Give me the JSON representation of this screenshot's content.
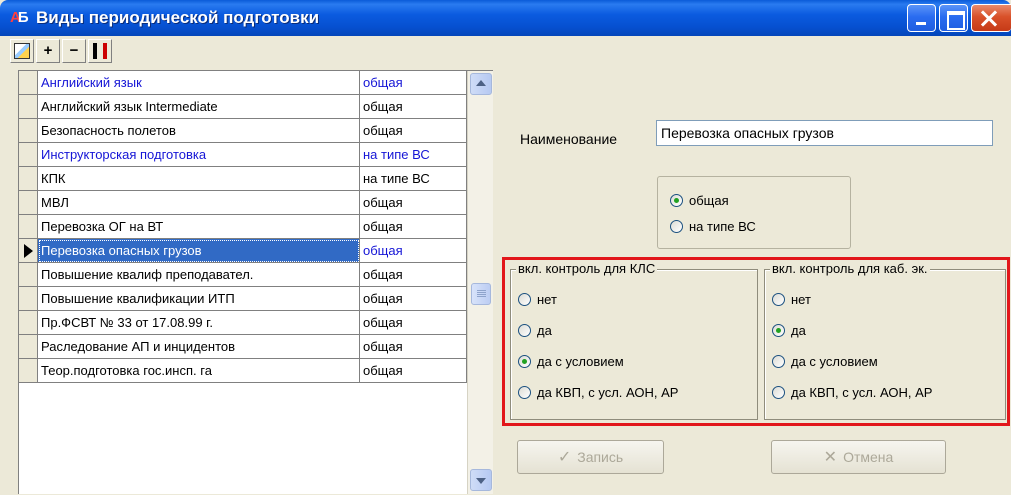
{
  "window": {
    "title": "Виды периодической подготовки",
    "icon_text": [
      "А",
      "Б"
    ]
  },
  "toolbar": {
    "edit_icon": "edit-document-icon",
    "add_icon": "+",
    "remove_icon": "−",
    "move_icon": "move-icon"
  },
  "grid": {
    "rows": [
      {
        "name": "Английский язык",
        "type": "общая",
        "blue": true,
        "selected": false
      },
      {
        "name": "Английский язык Intermediate",
        "type": "общая",
        "blue": false,
        "selected": false
      },
      {
        "name": "Безопасность полетов",
        "type": "общая",
        "blue": false,
        "selected": false
      },
      {
        "name": "Инструкторская подготовка",
        "type": "на типе ВС",
        "blue": true,
        "selected": false
      },
      {
        "name": "КПК",
        "type": "на типе ВС",
        "blue": false,
        "selected": false
      },
      {
        "name": "МВЛ",
        "type": "общая",
        "blue": false,
        "selected": false
      },
      {
        "name": "Перевозка ОГ на ВТ",
        "type": "общая",
        "blue": false,
        "selected": false
      },
      {
        "name": "Перевозка опасных грузов",
        "type": "общая",
        "blue": true,
        "selected": true
      },
      {
        "name": "Повышение квалиф преподавател.",
        "type": "общая",
        "blue": false,
        "selected": false
      },
      {
        "name": "Повышение квалификации ИТП",
        "type": "общая",
        "blue": false,
        "selected": false
      },
      {
        "name": "Пр.ФСВТ № 33 от 17.08.99 г.",
        "type": "общая",
        "blue": false,
        "selected": false
      },
      {
        "name": "Раследование АП и инцидентов",
        "type": "общая",
        "blue": false,
        "selected": false
      },
      {
        "name": "Теор.подготовка гос.инсп. га",
        "type": "общая",
        "blue": false,
        "selected": false
      }
    ]
  },
  "form": {
    "name_label": "Наименование",
    "name_value": "Перевозка опасных грузов",
    "type_options": [
      {
        "label": "общая",
        "checked": true
      },
      {
        "label": "на типе ВС",
        "checked": false
      }
    ],
    "klc_group": {
      "title": "вкл. контроль для КЛС",
      "options": [
        {
          "label": "нет",
          "checked": false
        },
        {
          "label": "да",
          "checked": false
        },
        {
          "label": "да с условием",
          "checked": true
        },
        {
          "label": "да КВП, с усл. АОН, АР",
          "checked": false
        }
      ]
    },
    "kab_group": {
      "title": "вкл. контроль для каб. эк.",
      "options": [
        {
          "label": "нет",
          "checked": false
        },
        {
          "label": "да",
          "checked": true
        },
        {
          "label": "да с условием",
          "checked": false
        },
        {
          "label": "да КВП, с усл. АОН, АР",
          "checked": false
        }
      ]
    },
    "save_label": "Запись",
    "cancel_label": "Отмена"
  }
}
